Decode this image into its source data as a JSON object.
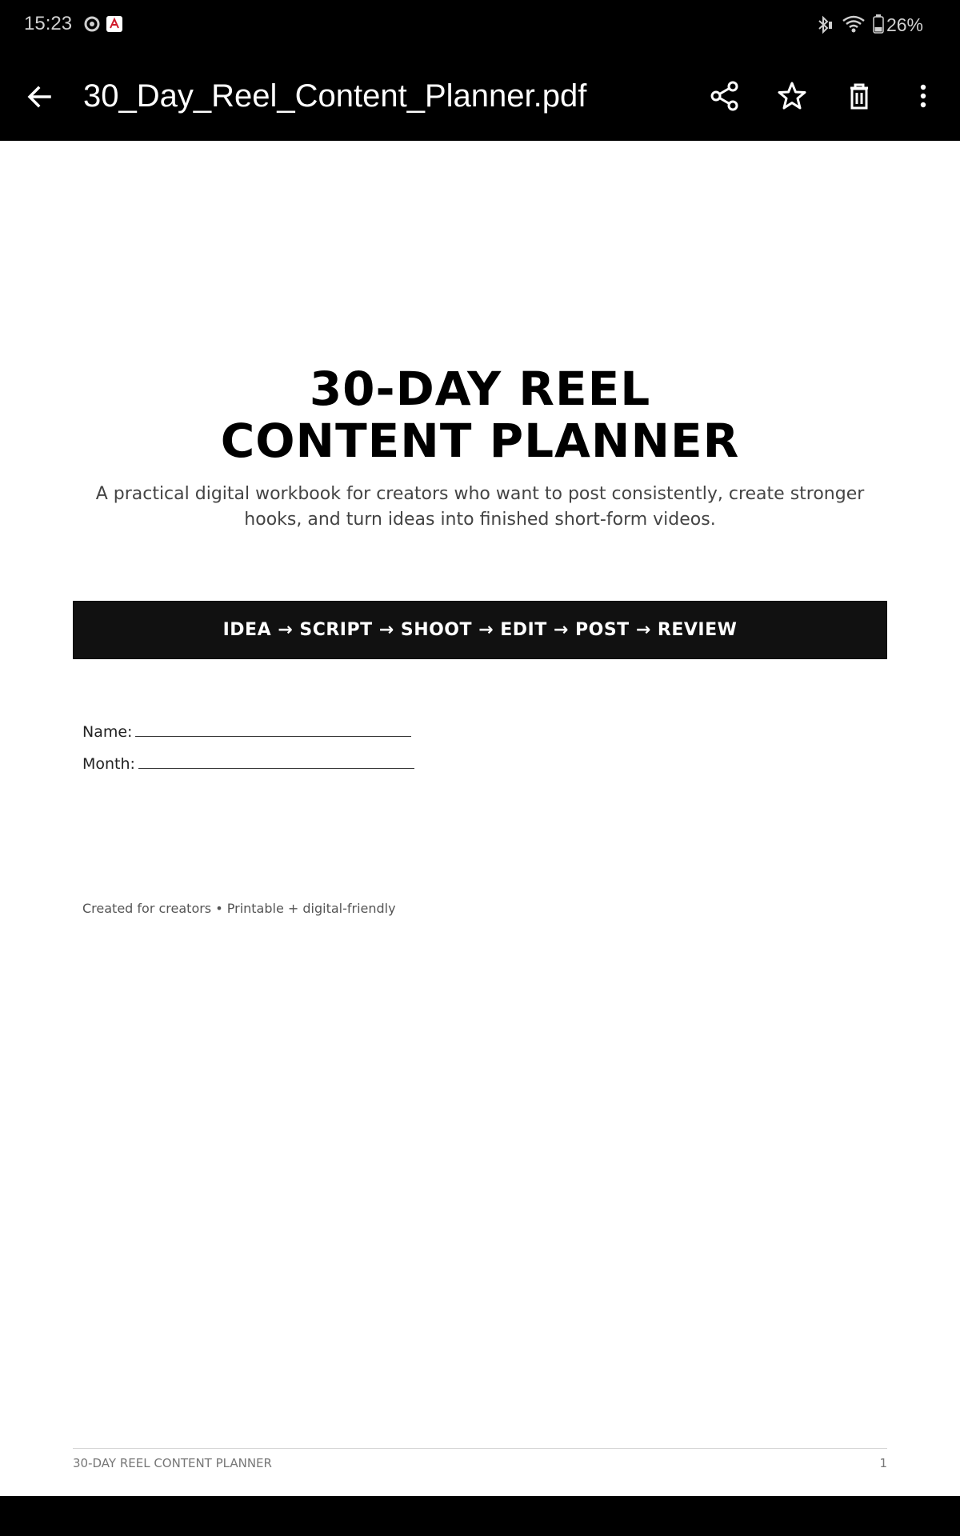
{
  "status_bar": {
    "time": "15:23",
    "battery": "26%",
    "icons": [
      "chrome-icon",
      "acrobat-icon",
      "bluetooth-icon",
      "wifi-icon",
      "battery-icon"
    ]
  },
  "app_bar": {
    "title": "30_Day_Reel_Content_Planner.pdf",
    "actions": [
      "back-arrow-icon",
      "share-icon",
      "star-icon",
      "delete-icon",
      "more-vert-icon"
    ]
  },
  "document": {
    "title_line1": "30-DAY REEL",
    "title_line2": "CONTENT PLANNER",
    "subtitle": "A practical digital workbook for creators who want to post consistently, create stronger hooks, and turn ideas into finished short-form videos.",
    "banner": "IDEA → SCRIPT → SHOOT → EDIT → POST → REVIEW",
    "name_label": "Name:",
    "month_label": "Month:",
    "created_note": "Created for creators • Printable + digital-friendly",
    "footer_left": "30-DAY REEL CONTENT PLANNER",
    "footer_page": "1"
  },
  "colors": {
    "app_bar_bg": "#000000",
    "banner_bg": "#111111",
    "page_bg": "#ffffff"
  }
}
